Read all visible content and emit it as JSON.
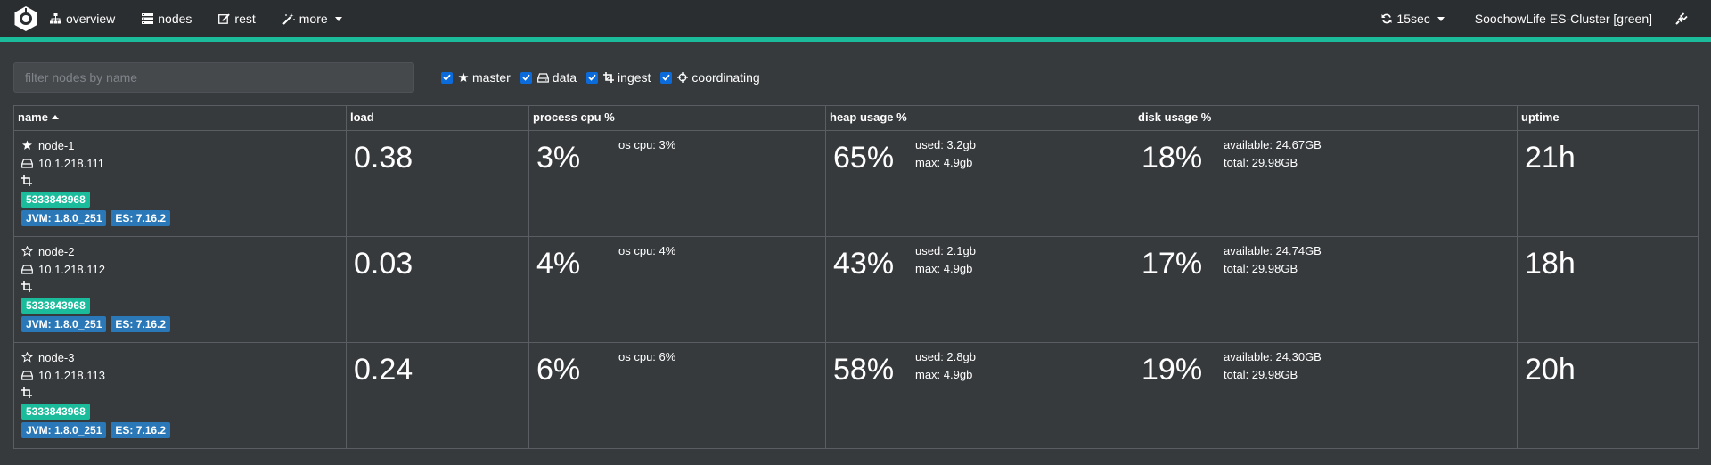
{
  "navbar": {
    "items": [
      {
        "label": "overview",
        "icon": "sitemap-icon"
      },
      {
        "label": "nodes",
        "icon": "server-icon"
      },
      {
        "label": "rest",
        "icon": "edit-icon"
      },
      {
        "label": "more",
        "icon": "magic-wand-icon"
      }
    ],
    "refresh_label": "15sec",
    "cluster_name": "SoochowLife ES-Cluster [green]",
    "accent_color": "#1abc9c"
  },
  "filter": {
    "placeholder": "filter nodes by name",
    "value": ""
  },
  "roles": [
    {
      "label": "master",
      "checked": true,
      "icon": "star-icon"
    },
    {
      "label": "data",
      "checked": true,
      "icon": "hdd-icon"
    },
    {
      "label": "ingest",
      "checked": true,
      "icon": "crop-icon"
    },
    {
      "label": "coordinating",
      "checked": true,
      "icon": "crosshairs-icon"
    }
  ],
  "table": {
    "headers": [
      "name",
      "load",
      "process cpu %",
      "heap usage %",
      "disk usage %",
      "uptime"
    ],
    "rows": [
      {
        "name": "node-1",
        "master": true,
        "ip": "10.1.218.111",
        "id": "5333843968",
        "jvm": "JVM: 1.8.0_251",
        "es": "ES: 7.16.2",
        "load": "0.38",
        "cpu": "3%",
        "os_cpu": "os cpu: 3%",
        "heap": "65%",
        "heap_used": "used: 3.2gb",
        "heap_max": "max: 4.9gb",
        "disk": "18%",
        "disk_available": "available: 24.67GB",
        "disk_total": "total: 29.98GB",
        "uptime": "21h"
      },
      {
        "name": "node-2",
        "master": false,
        "ip": "10.1.218.112",
        "id": "5333843968",
        "jvm": "JVM: 1.8.0_251",
        "es": "ES: 7.16.2",
        "load": "0.03",
        "cpu": "4%",
        "os_cpu": "os cpu: 4%",
        "heap": "43%",
        "heap_used": "used: 2.1gb",
        "heap_max": "max: 4.9gb",
        "disk": "17%",
        "disk_available": "available: 24.74GB",
        "disk_total": "total: 29.98GB",
        "uptime": "18h"
      },
      {
        "name": "node-3",
        "master": false,
        "ip": "10.1.218.113",
        "id": "5333843968",
        "jvm": "JVM: 1.8.0_251",
        "es": "ES: 7.16.2",
        "load": "0.24",
        "cpu": "6%",
        "os_cpu": "os cpu: 6%",
        "heap": "58%",
        "heap_used": "used: 2.8gb",
        "heap_max": "max: 4.9gb",
        "disk": "19%",
        "disk_available": "available: 24.30GB",
        "disk_total": "total: 29.98GB",
        "uptime": "20h"
      }
    ]
  }
}
